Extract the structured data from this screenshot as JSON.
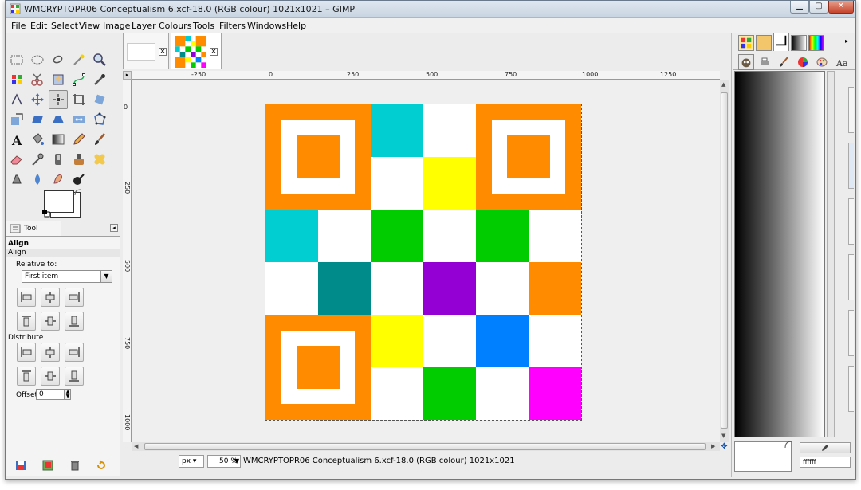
{
  "window": {
    "title": "WMCRYPTOPR06 Conceptualism 6.xcf-18.0 (RGB colour) 1021x1021 – GIMP",
    "controls": {
      "minimize": "▁",
      "maximize": "▢",
      "close": "✕"
    }
  },
  "menubar": {
    "items": [
      "File",
      "Edit",
      "Select",
      "View",
      "Image",
      "Layer",
      "Colours",
      "Tools",
      "Filters",
      "Windows",
      "Help"
    ]
  },
  "toolbox": {
    "tools": [
      "rect-select",
      "ellipse-select",
      "free-select",
      "fuzzy-select",
      "select-by-color",
      "scissors-select",
      "foreground-select",
      "paths",
      "color-picker",
      "zoom",
      "measure",
      "move",
      "align",
      "crop",
      "rotate",
      "scale",
      "shear",
      "perspective",
      "flip",
      "cage-transform",
      "text",
      "bucket-fill",
      "blend",
      "pencil",
      "paintbrush",
      "eraser",
      "airbrush",
      "ink",
      "clone",
      "heal",
      "perspective-clone",
      "blur",
      "smudge",
      "dodge-burn"
    ],
    "active_tool": "align"
  },
  "tool_options": {
    "tab_label": "Tool Options",
    "heading": "Align",
    "subheading": "Align",
    "relative_to_label": "Relative to:",
    "relative_to_value": "First item",
    "distribute_label": "Distribute",
    "offset_label": "Offset:",
    "offset_value": "0"
  },
  "rulers": {
    "horizontal": [
      "-250",
      "0",
      "250",
      "500",
      "750",
      "1000",
      "1250"
    ],
    "vertical": [
      "0",
      "250",
      "500",
      "750",
      "1000"
    ]
  },
  "canvas": {
    "grid_size": 6,
    "cells": [
      {
        "r": 0,
        "c": 2,
        "color": "#00CED1"
      },
      {
        "r": 0,
        "c": 3,
        "color": "#FFFFFF"
      },
      {
        "r": 1,
        "c": 2,
        "color": "#FFFFFF"
      },
      {
        "r": 1,
        "c": 3,
        "color": "#FFFF00"
      },
      {
        "r": 2,
        "c": 0,
        "color": "#00CED1"
      },
      {
        "r": 2,
        "c": 1,
        "color": "#FFFFFF"
      },
      {
        "r": 2,
        "c": 2,
        "color": "#00CC00"
      },
      {
        "r": 2,
        "c": 3,
        "color": "#FFFFFF"
      },
      {
        "r": 2,
        "c": 4,
        "color": "#00CC00"
      },
      {
        "r": 2,
        "c": 5,
        "color": "#FFFFFF"
      },
      {
        "r": 3,
        "c": 0,
        "color": "#FFFFFF"
      },
      {
        "r": 3,
        "c": 1,
        "color": "#008B8B"
      },
      {
        "r": 3,
        "c": 2,
        "color": "#FFFFFF"
      },
      {
        "r": 3,
        "c": 3,
        "color": "#9400D3"
      },
      {
        "r": 3,
        "c": 4,
        "color": "#FFFFFF"
      },
      {
        "r": 3,
        "c": 5,
        "color": "#FF8C00"
      },
      {
        "r": 4,
        "c": 2,
        "color": "#FFFF00"
      },
      {
        "r": 4,
        "c": 3,
        "color": "#FFFFFF"
      },
      {
        "r": 4,
        "c": 4,
        "color": "#007FFF"
      },
      {
        "r": 4,
        "c": 5,
        "color": "#FFFFFF"
      },
      {
        "r": 5,
        "c": 2,
        "color": "#FFFFFF"
      },
      {
        "r": 5,
        "c": 3,
        "color": "#00CC00"
      },
      {
        "r": 5,
        "c": 4,
        "color": "#FFFFFF"
      },
      {
        "r": 5,
        "c": 5,
        "color": "#FF00FF"
      }
    ],
    "finders": [
      {
        "r": 0,
        "c": 0,
        "color": "#FF8C00"
      },
      {
        "r": 0,
        "c": 4,
        "color": "#FF8C00"
      },
      {
        "r": 4,
        "c": 0,
        "color": "#FF8C00"
      }
    ]
  },
  "statusbar": {
    "unit": "px",
    "zoom": "50 %",
    "text": "WMCRYPTOPR06 Conceptualism 6.xcf-18.0 (RGB colour) 1021x1021"
  },
  "dock": {
    "hex_value": "ffffff"
  }
}
